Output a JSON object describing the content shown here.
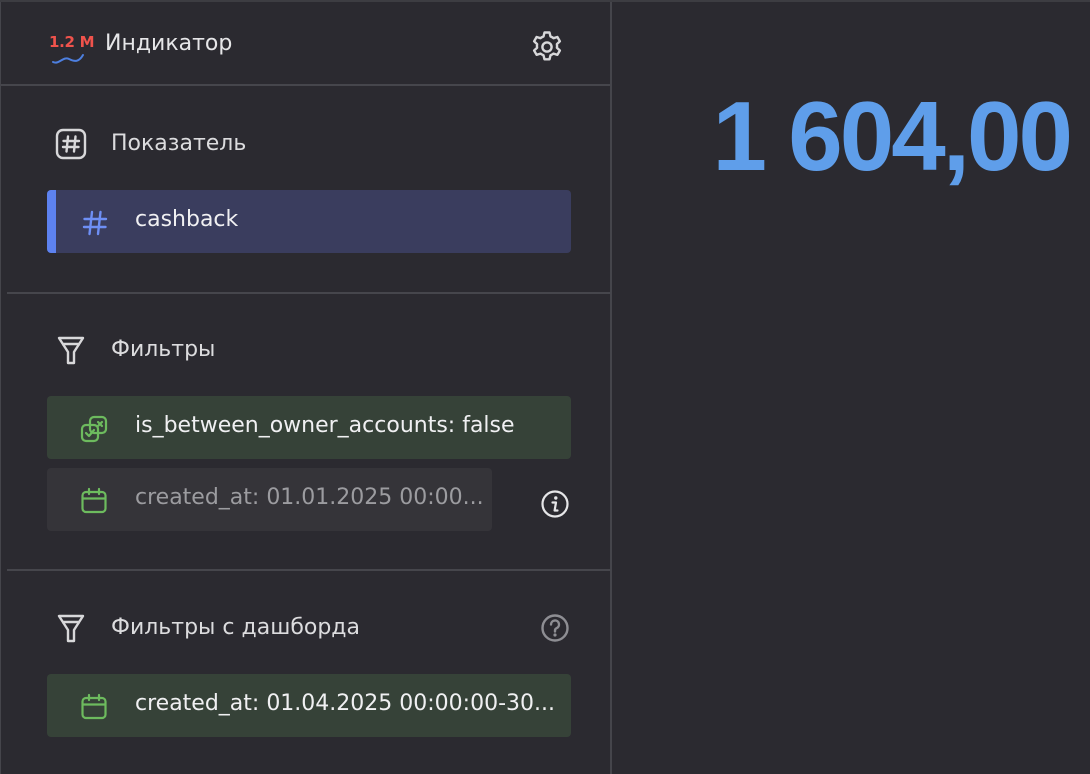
{
  "header": {
    "logo_text": "1.2 M",
    "title": "Индикатор",
    "settings_icon": "gear-icon"
  },
  "measure_section": {
    "title": "Показатель",
    "icon": "hash-square-icon",
    "items": [
      {
        "label": "cashback",
        "icon": "hash-icon",
        "accent": "#5d82f0"
      }
    ]
  },
  "filters_section": {
    "title": "Фильтры",
    "icon": "funnel-icon",
    "items": [
      {
        "label": "is_between_owner_accounts: false",
        "icon": "boolean-icon"
      },
      {
        "label": "created_at: 01.01.2025 00:00...",
        "icon": "calendar-icon"
      }
    ],
    "info_icon": "info-icon"
  },
  "dashboard_filters_section": {
    "title": "Фильтры с дашборда",
    "icon": "funnel-icon",
    "help_icon": "question-icon",
    "items": [
      {
        "label": "created_at: 01.04.2025 00:00:00-30...",
        "icon": "calendar-icon"
      }
    ]
  },
  "indicator": {
    "value": "1 604,00",
    "color": "#5f9eea"
  },
  "colors": {
    "background": "#2b2a30",
    "measure_chip": "#3a3d5e",
    "filter_chip_green": "#364238",
    "filter_chip_gray": "#353439",
    "icon_green": "#6dbb5e"
  }
}
